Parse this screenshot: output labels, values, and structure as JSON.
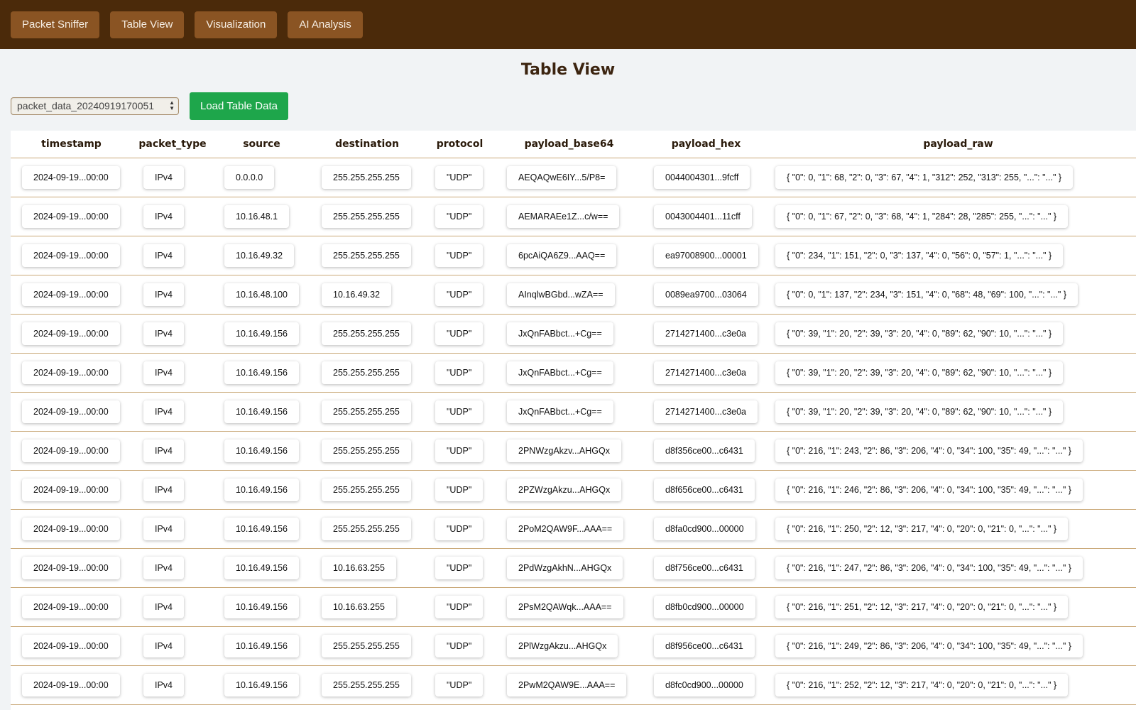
{
  "nav": {
    "tabs": [
      "Packet Sniffer",
      "Table View",
      "Visualization",
      "AI Analysis"
    ]
  },
  "page": {
    "title": "Table View"
  },
  "controls": {
    "file_select_value": "packet_data_20240919170051",
    "load_button_label": "Load Table Data"
  },
  "colors": {
    "nav_bg": "#4b2a0a",
    "nav_button": "#8a5423",
    "load_button": "#1ea64b",
    "row_border": "#c9a877"
  },
  "icons": {
    "select_arrows": "updown-chevron-icon"
  },
  "table": {
    "columns": [
      "timestamp",
      "packet_type",
      "source",
      "destination",
      "protocol",
      "payload_base64",
      "payload_hex",
      "payload_raw"
    ],
    "rows": [
      [
        "2024-09-19...00:00",
        "IPv4",
        "0.0.0.0",
        "255.255.255.255",
        "\"UDP\"",
        "AEQAQwE6IY...5/P8=",
        "0044004301...9fcff",
        "{ \"0\": 0, \"1\": 68, \"2\": 0, \"3\": 67, \"4\": 1, \"312\": 252, \"313\": 255, \"...\": \"...\" }"
      ],
      [
        "2024-09-19...00:00",
        "IPv4",
        "10.16.48.1",
        "255.255.255.255",
        "\"UDP\"",
        "AEMARAEe1Z...c/w==",
        "0043004401...11cff",
        "{ \"0\": 0, \"1\": 67, \"2\": 0, \"3\": 68, \"4\": 1, \"284\": 28, \"285\": 255, \"...\": \"...\" }"
      ],
      [
        "2024-09-19...00:00",
        "IPv4",
        "10.16.49.32",
        "255.255.255.255",
        "\"UDP\"",
        "6pcAiQA6Z9...AAQ==",
        "ea97008900...00001",
        "{ \"0\": 234, \"1\": 151, \"2\": 0, \"3\": 137, \"4\": 0, \"56\": 0, \"57\": 1, \"...\": \"...\" }"
      ],
      [
        "2024-09-19...00:00",
        "IPv4",
        "10.16.48.100",
        "10.16.49.32",
        "\"UDP\"",
        "AInqlwBGbd...wZA==",
        "0089ea9700...03064",
        "{ \"0\": 0, \"1\": 137, \"2\": 234, \"3\": 151, \"4\": 0, \"68\": 48, \"69\": 100, \"...\": \"...\" }"
      ],
      [
        "2024-09-19...00:00",
        "IPv4",
        "10.16.49.156",
        "255.255.255.255",
        "\"UDP\"",
        "JxQnFABbct...+Cg==",
        "2714271400...c3e0a",
        "{ \"0\": 39, \"1\": 20, \"2\": 39, \"3\": 20, \"4\": 0, \"89\": 62, \"90\": 10, \"...\": \"...\" }"
      ],
      [
        "2024-09-19...00:00",
        "IPv4",
        "10.16.49.156",
        "255.255.255.255",
        "\"UDP\"",
        "JxQnFABbct...+Cg==",
        "2714271400...c3e0a",
        "{ \"0\": 39, \"1\": 20, \"2\": 39, \"3\": 20, \"4\": 0, \"89\": 62, \"90\": 10, \"...\": \"...\" }"
      ],
      [
        "2024-09-19...00:00",
        "IPv4",
        "10.16.49.156",
        "255.255.255.255",
        "\"UDP\"",
        "JxQnFABbct...+Cg==",
        "2714271400...c3e0a",
        "{ \"0\": 39, \"1\": 20, \"2\": 39, \"3\": 20, \"4\": 0, \"89\": 62, \"90\": 10, \"...\": \"...\" }"
      ],
      [
        "2024-09-19...00:00",
        "IPv4",
        "10.16.49.156",
        "255.255.255.255",
        "\"UDP\"",
        "2PNWzgAkzv...AHGQx",
        "d8f356ce00...c6431",
        "{ \"0\": 216, \"1\": 243, \"2\": 86, \"3\": 206, \"4\": 0, \"34\": 100, \"35\": 49, \"...\": \"...\" }"
      ],
      [
        "2024-09-19...00:00",
        "IPv4",
        "10.16.49.156",
        "255.255.255.255",
        "\"UDP\"",
        "2PZWzgAkzu...AHGQx",
        "d8f656ce00...c6431",
        "{ \"0\": 216, \"1\": 246, \"2\": 86, \"3\": 206, \"4\": 0, \"34\": 100, \"35\": 49, \"...\": \"...\" }"
      ],
      [
        "2024-09-19...00:00",
        "IPv4",
        "10.16.49.156",
        "255.255.255.255",
        "\"UDP\"",
        "2PoM2QAW9F...AAA==",
        "d8fa0cd900...00000",
        "{ \"0\": 216, \"1\": 250, \"2\": 12, \"3\": 217, \"4\": 0, \"20\": 0, \"21\": 0, \"...\": \"...\" }"
      ],
      [
        "2024-09-19...00:00",
        "IPv4",
        "10.16.49.156",
        "10.16.63.255",
        "\"UDP\"",
        "2PdWzgAkhN...AHGQx",
        "d8f756ce00...c6431",
        "{ \"0\": 216, \"1\": 247, \"2\": 86, \"3\": 206, \"4\": 0, \"34\": 100, \"35\": 49, \"...\": \"...\" }"
      ],
      [
        "2024-09-19...00:00",
        "IPv4",
        "10.16.49.156",
        "10.16.63.255",
        "\"UDP\"",
        "2PsM2QAWqk...AAA==",
        "d8fb0cd900...00000",
        "{ \"0\": 216, \"1\": 251, \"2\": 12, \"3\": 217, \"4\": 0, \"20\": 0, \"21\": 0, \"...\": \"...\" }"
      ],
      [
        "2024-09-19...00:00",
        "IPv4",
        "10.16.49.156",
        "255.255.255.255",
        "\"UDP\"",
        "2PlWzgAkzu...AHGQx",
        "d8f956ce00...c6431",
        "{ \"0\": 216, \"1\": 249, \"2\": 86, \"3\": 206, \"4\": 0, \"34\": 100, \"35\": 49, \"...\": \"...\" }"
      ],
      [
        "2024-09-19...00:00",
        "IPv4",
        "10.16.49.156",
        "255.255.255.255",
        "\"UDP\"",
        "2PwM2QAW9E...AAA==",
        "d8fc0cd900...00000",
        "{ \"0\": 216, \"1\": 252, \"2\": 12, \"3\": 217, \"4\": 0, \"20\": 0, \"21\": 0, \"...\": \"...\" }"
      ]
    ]
  }
}
